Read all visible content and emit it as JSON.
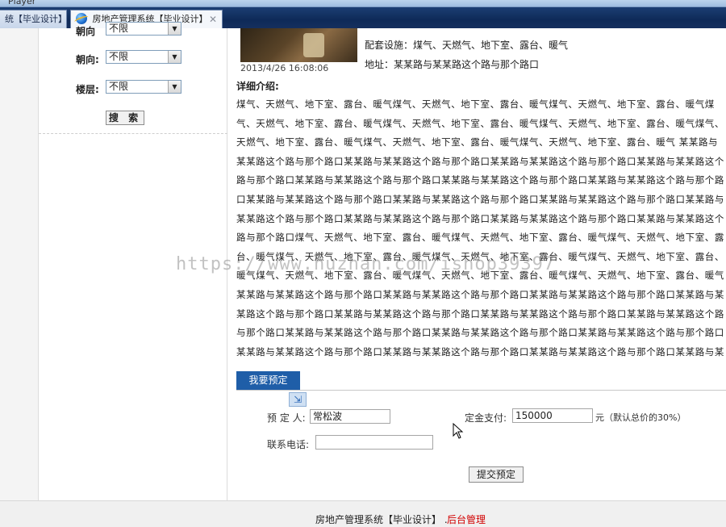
{
  "window": {
    "title_fragment": "Player"
  },
  "tabs": [
    {
      "label": "统【毕业设计】",
      "active": false
    },
    {
      "label": "房地产管理系统【毕业设计】",
      "active": true
    }
  ],
  "filters": {
    "partial": {
      "label": "朝向",
      "value": "不限"
    },
    "orientation": {
      "label": "朝向:",
      "value": "不限"
    },
    "floor": {
      "label": "楼层:",
      "value": "不限"
    },
    "search_label": "搜 索"
  },
  "listing": {
    "photo_date": "2013/4/26 16:08:06",
    "facilities": "配套设施：煤气、天燃气、地下室、露台、暖气",
    "address": "地址：某某路与某某路这个路与那个路口",
    "detail_label": "详细介绍:",
    "detail_text": "煤气、天燃气、地下室、露台、暖气煤气、天燃气、地下室、露台、暖气煤气、天燃气、地下室、露台、暖气煤气、天燃气、地下室、露台、暖气煤气、天燃气、地下室、露台、暖气煤气、天燃气、地下室、露台、暖气煤气、天燃气、地下室、露台、暖气煤气、天燃气、地下室、露台、暖气煤气、天燃气、地下室、露台、暖气 某某路与某某路这个路与那个路口某某路与某某路这个路与那个路口某某路与某某路这个路与那个路口某某路与某某路这个路与那个路口某某路与某某路这个路与那个路口某某路与某某路这个路与那个路口某某路与某某路这个路与那个路口某某路与某某路这个路与那个路口某某路与某某路这个路与那个路口某某路与某某路这个路与那个路口某某路与某某路这个路与那个路口某某路与某某路这个路与那个路口某某路与某某路这个路与那个路口某某路与某某路这个路与那个路口煤气、天燃气、地下室、露台、暖气煤气、天燃气、地下室、露台、暖气煤气、天燃气、地下室、露台、暖气煤气、天燃气、地下室、露台、暖气煤气、天燃气、地下室、露台、暖气煤气、天燃气、地下室、露台、暖气煤气、天燃气、地下室、露台、暖气煤气、天燃气、地下室、露台、暖气煤气、天燃气、地下室、露台、暖气 某某路与某某路这个路与那个路口某某路与某某路这个路与那个路口某某路与某某路这个路与那个路口某某路与某某路这个路与那个路口某某路与某某路这个路与那个路口某某路与某某路这个路与那个路口某某路与某某路这个路与那个路口某某路与某某路这个路与那个路口某某路与某某路这个路与那个路口某某路与某某路这个路与那个路口某某路与某某路这个路与那个路口某某路与某某路这个路与那个路口某某路与某某路这个路与那个路口某某路与某某路这个路与那个路口"
  },
  "reservation": {
    "tab_label": "我要预定",
    "booker_label": "预 定 人:",
    "booker_value": "常松波",
    "phone_label": "联系电话:",
    "phone_value": "",
    "deposit_label": "定金支付:",
    "deposit_value": "150000",
    "deposit_note": "元（默认总价的30%）",
    "submit_label": "提交预定"
  },
  "footer": {
    "text": "房地产管理系统【毕业设计】 .",
    "admin_link": "后台管理"
  },
  "watermark": "https://www.huzhan.com/ishop39397"
}
